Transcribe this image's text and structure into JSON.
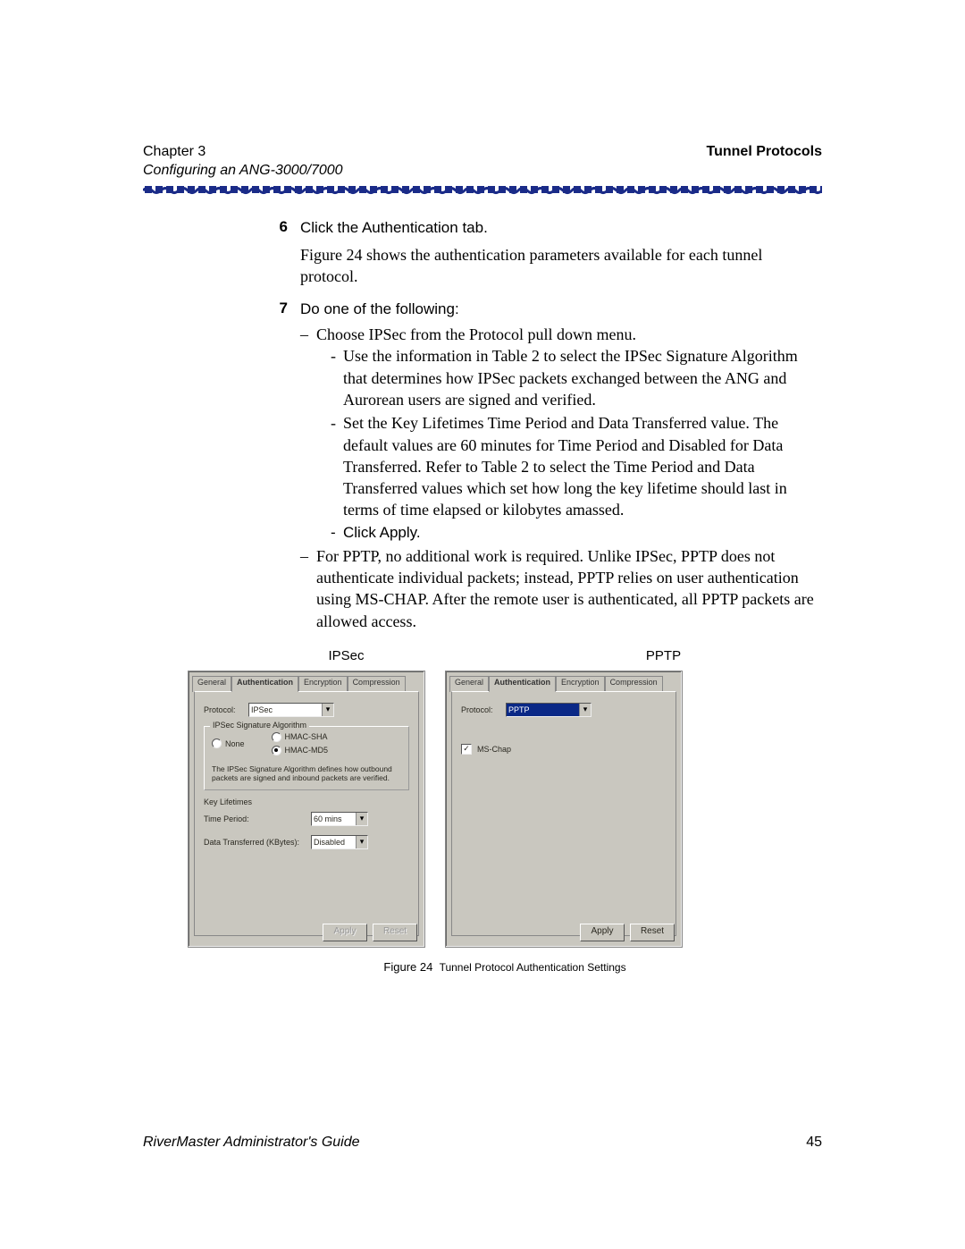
{
  "header": {
    "chapter": "Chapter 3",
    "subtitle": "Configuring an ANG-3000/7000",
    "topic": "Tunnel Protocols"
  },
  "steps": {
    "s6": {
      "num": "6",
      "title": "Click the Authentication tab.",
      "para": "Figure 24 shows the authentication parameters available for each tunnel protocol."
    },
    "s7": {
      "num": "7",
      "title": "Do one of the following:",
      "b1": "Choose IPSec from the Protocol pull down menu.",
      "b1a": "Use the information in Table 2 to select the IPSec Signature Algorithm that determines how IPSec packets exchanged between the ANG and Aurorean users are signed and verified.",
      "b1b": "Set the Key Lifetimes Time Period and Data Transferred value. The default values are 60 minutes for Time Period and Disabled for Data Transferred. Refer to Table 2 to select the Time Period and Data Transferred values which set how long the key lifetime should last in terms of time elapsed or kilobytes amassed.",
      "b1c": "Click Apply.",
      "b2": "For PPTP, no additional work is required. Unlike IPSec, PPTP does not authenticate individual packets; instead, PPTP relies on user authentication using MS-CHAP. After the remote user is authenticated, all PPTP packets are allowed access."
    }
  },
  "figure": {
    "label_left": "IPSec",
    "label_right": "PPTP",
    "tabs": {
      "general": "General",
      "auth": "Authentication",
      "enc": "Encryption",
      "comp": "Compression"
    },
    "protocol_lbl": "Protocol:",
    "ipsec_proto": "IPSec",
    "pptp_proto": "PPTP",
    "sig_group": "IPSec Signature Algorithm",
    "radio_none": "None",
    "radio_sha": "HMAC-SHA",
    "radio_md5": "HMAC-MD5",
    "sig_desc": "The IPSec Signature Algorithm defines how outbound packets are signed and inbound packets are verified.",
    "key_group": "Key Lifetimes",
    "time_period": "Time Period:",
    "time_val": "60 mins",
    "data_trans": "Data Transferred (KBytes):",
    "data_val": "Disabled",
    "mschap": "MS-Chap",
    "apply": "Apply",
    "reset": "Reset",
    "caption_prefix": "Figure 24",
    "caption_text": "Tunnel Protocol Authentication Settings"
  },
  "footer": {
    "guide": "RiverMaster Administrator's Guide",
    "page": "45"
  }
}
